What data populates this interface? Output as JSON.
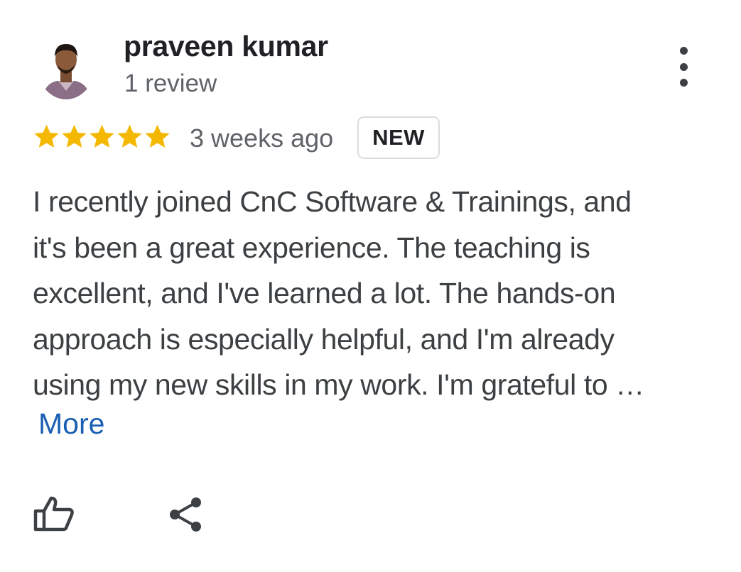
{
  "review": {
    "author_name": "praveen kumar",
    "review_count": "1 review",
    "rating": 5,
    "rating_max": 5,
    "time_ago": "3 weeks ago",
    "badge": "NEW",
    "text_lines": [
      "I recently joined CnC Software & Trainings, and",
      "it's been a great experience. The teaching is",
      "excellent, and I've learned a lot. The hands-on",
      "approach is especially helpful, and I'm already",
      "using my new skills in my work. I'm grateful to …"
    ],
    "more_label": "More"
  },
  "icons": {
    "avatar": "person-avatar",
    "menu": "more-vert-icon",
    "star": "star-icon",
    "like": "thumb-up-icon",
    "share": "share-icon"
  },
  "colors": {
    "star": "#f5b800",
    "link": "#1a5fb4",
    "text": "#3c4043",
    "secondary": "#5f6368"
  }
}
